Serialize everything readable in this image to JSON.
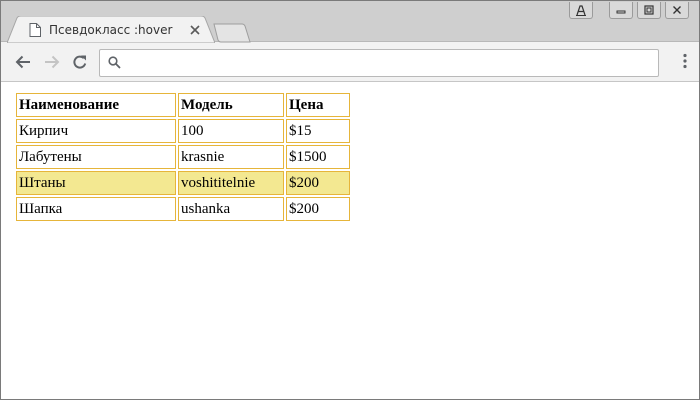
{
  "tab": {
    "title": "Псевдокласс :hover"
  },
  "omnibox": {
    "value": "",
    "placeholder": ""
  },
  "table": {
    "headers": [
      "Наименование",
      "Модель",
      "Цена"
    ],
    "rows": [
      [
        "Кирпич",
        "100",
        "$15"
      ],
      [
        "Лабутены",
        "krasnie",
        "$1500"
      ],
      [
        "Штаны",
        "voshititelnie",
        "$200"
      ],
      [
        "Шапка",
        "ushanka",
        "$200"
      ]
    ],
    "hovered_row_index": 2
  },
  "colors": {
    "cell_border": "#e6b53a",
    "hover_background": "#f3e891"
  },
  "icons": {
    "tab": "page-icon",
    "close": "close-icon",
    "back": "back-arrow-icon",
    "forward": "forward-arrow-icon",
    "reload": "reload-icon",
    "search": "search-icon",
    "menu": "kebab-menu-icon",
    "user": "user-icon",
    "minimize": "minimize-icon",
    "restore": "restore-icon",
    "close_window": "close-window-icon"
  }
}
